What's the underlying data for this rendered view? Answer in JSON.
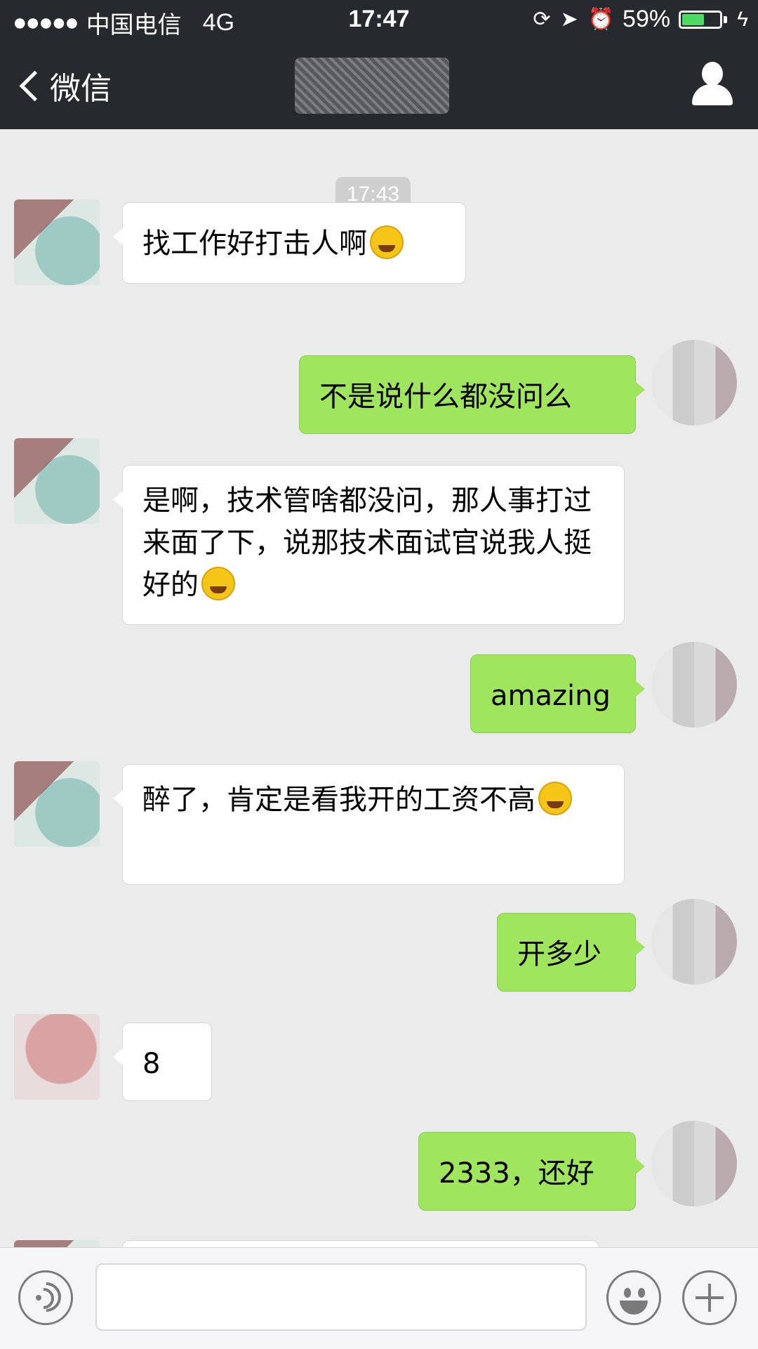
{
  "status_bar": {
    "signal_dots": "●●●●●",
    "carrier": "中国电信",
    "network": "4G",
    "time": "17:47",
    "battery_percent": "59%",
    "battery_level": 0.59,
    "battery_fill_color": "#4cd964"
  },
  "nav": {
    "back_label": "微信",
    "profile_icon": "person-icon"
  },
  "chat": {
    "time_divider": "17:43",
    "messages": [
      {
        "side": "in",
        "text": "找工作好打击人啊",
        "emoji": "facepalm-emoji"
      },
      {
        "side": "out",
        "text": "不是说什么都没问么"
      },
      {
        "side": "in",
        "text": "是啊，技术管啥都没问，那人事打过来面了下，说那技术面试官说我人挺好的",
        "emoji": "laughing-tears-emoji"
      },
      {
        "side": "out",
        "text": "amazing"
      },
      {
        "side": "in",
        "text": "醉了，肯定是看我开的工资不高",
        "emoji": "facepalm-emoji"
      },
      {
        "side": "out",
        "text": "开多少"
      },
      {
        "side": "in",
        "text": "8"
      },
      {
        "side": "out",
        "text": "2333，还好"
      }
    ]
  },
  "input_bar": {
    "voice_icon": "voice-icon",
    "emoji_icon": "smiley-icon",
    "plus_icon": "plus-icon"
  },
  "colors": {
    "header_bg": "#26292e",
    "chat_bg": "#ebebeb",
    "outgoing_bubble": "#9fe65e",
    "incoming_bubble": "#ffffff"
  }
}
